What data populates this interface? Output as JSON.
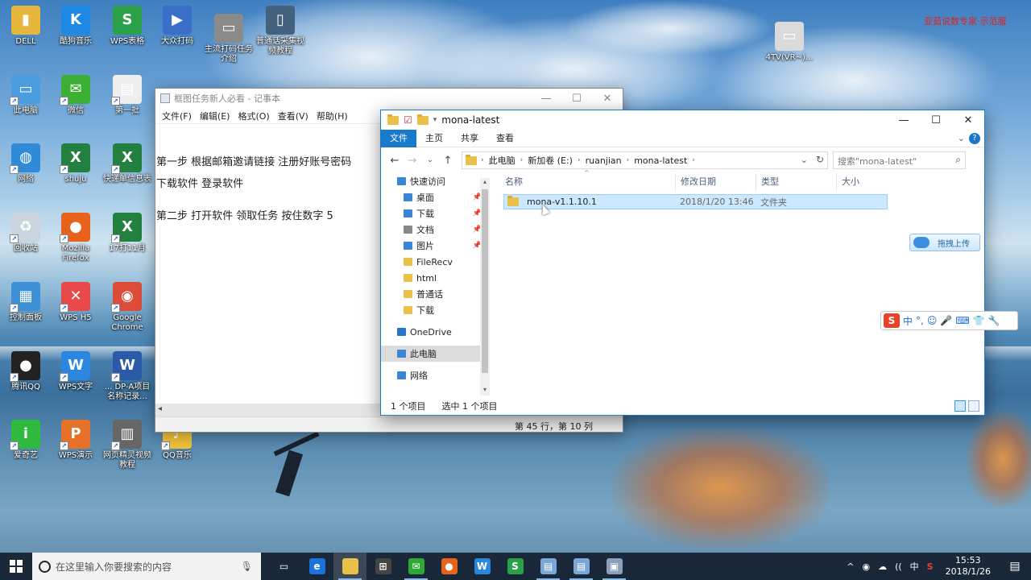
{
  "desktop": {
    "top_right_note": "亚茹说数专家·示范服",
    "icons": [
      {
        "label": "DELL",
        "icon": "user-folder-icon",
        "color": "#e7b63c"
      },
      {
        "label": "酷狗音乐",
        "icon": "kugou-icon",
        "color": "#1e88e5"
      },
      {
        "label": "WPS表格",
        "icon": "wps-sheet-icon",
        "color": "#2aa148"
      },
      {
        "label": "大众打码",
        "icon": "video-file-icon",
        "color": "#3a6fc9"
      },
      {
        "label": "主流打码任务介绍",
        "icon": "screen-icon",
        "color": "#8a8a8a"
      },
      {
        "label": "普通话采集视频教程",
        "icon": "phone-icon",
        "color": "#44617d"
      },
      {
        "label": "4TV(VR~)...",
        "icon": "tv-icon",
        "color": "#dadada"
      },
      {
        "label": "此电脑",
        "icon": "computer-icon",
        "color": "#4c9de0"
      },
      {
        "label": "微信",
        "icon": "wechat-icon",
        "color": "#3cb034"
      },
      {
        "label": "第一批",
        "icon": "document-icon",
        "color": "#eeeeee"
      },
      {
        "label": "网络",
        "icon": "network-icon",
        "color": "#2f8ad8"
      },
      {
        "label": "shuju",
        "icon": "excel-icon",
        "color": "#22813f"
      },
      {
        "label": "快递单信息表",
        "icon": "excel-icon",
        "color": "#22813f"
      },
      {
        "label": "回收站",
        "icon": "recycle-bin-icon",
        "color": "#c9d4de"
      },
      {
        "label": "Mozilla Firefox",
        "icon": "firefox-icon",
        "color": "#e8621c"
      },
      {
        "label": "17打11月",
        "icon": "excel-icon",
        "color": "#22813f"
      },
      {
        "label": "控制面板",
        "icon": "control-panel-icon",
        "color": "#3d8fd6"
      },
      {
        "label": "WPS H5",
        "icon": "wps-h5-icon",
        "color": "#e84a4a"
      },
      {
        "label": "Google Chrome",
        "icon": "chrome-icon",
        "color": "#dd4b39"
      },
      {
        "label": "腾讯QQ",
        "icon": "qq-icon",
        "color": "#222222"
      },
      {
        "label": "WPS文字",
        "icon": "wps-writer-icon",
        "color": "#2b86e0"
      },
      {
        "label": "... DP-A项目名称记录...",
        "icon": "word-icon",
        "color": "#2b5aa8"
      },
      {
        "label": "爱奇艺",
        "icon": "iqiyi-icon",
        "color": "#2fb93e"
      },
      {
        "label": "WPS演示",
        "icon": "wps-slides-icon",
        "color": "#e8712a"
      },
      {
        "label": "网页精灵视频教程",
        "icon": "film-icon",
        "color": "#666666"
      },
      {
        "label": "QQ音乐",
        "icon": "qq-music-icon",
        "color": "#f2c33a"
      }
    ]
  },
  "notepad": {
    "title": "框图任务新人必看 - 记事本",
    "menu": [
      "文件(F)",
      "编辑(E)",
      "格式(O)",
      "查看(V)",
      "帮助(H)"
    ],
    "lines": [
      "第一步   根据邮箱邀请链接 注册好账号密码",
      "下载软件  登录软件",
      "",
      "第二步  打开软件  领取任务   按住数字  5"
    ],
    "status": "第 45 行，第 10 列",
    "controls": {
      "min": "—",
      "max": "☐",
      "close": "✕"
    }
  },
  "explorer": {
    "title": "mona-latest",
    "ribbon_tabs": [
      "文件",
      "主页",
      "共享",
      "查看"
    ],
    "help": "?",
    "breadcrumb": [
      "此电脑",
      "新加卷 (E:)",
      "ruanjian",
      "mona-latest"
    ],
    "search_placeholder": "搜索\"mona-latest\"",
    "nav_items": [
      {
        "label": "快速访问",
        "pinned": false,
        "indent": 0,
        "icon": "star-icon"
      },
      {
        "label": "桌面",
        "pinned": true,
        "indent": 1,
        "icon": "desktop-icon"
      },
      {
        "label": "下载",
        "pinned": true,
        "indent": 1,
        "icon": "download-icon"
      },
      {
        "label": "文档",
        "pinned": true,
        "indent": 1,
        "icon": "document-icon"
      },
      {
        "label": "图片",
        "pinned": true,
        "indent": 1,
        "icon": "picture-icon"
      },
      {
        "label": "FileRecv",
        "pinned": false,
        "indent": 1,
        "icon": "folder-icon"
      },
      {
        "label": "html",
        "pinned": false,
        "indent": 1,
        "icon": "folder-icon"
      },
      {
        "label": "普通话",
        "pinned": false,
        "indent": 1,
        "icon": "folder-icon"
      },
      {
        "label": "下载",
        "pinned": false,
        "indent": 1,
        "icon": "folder-icon"
      },
      {
        "label": "OneDrive",
        "pinned": false,
        "indent": 0,
        "icon": "cloud-icon"
      },
      {
        "label": "此电脑",
        "pinned": false,
        "indent": 0,
        "icon": "computer-icon",
        "selected": true
      },
      {
        "label": "网络",
        "pinned": false,
        "indent": 0,
        "icon": "network-icon"
      }
    ],
    "columns": [
      "名称",
      "修改日期",
      "类型",
      "大小"
    ],
    "files": [
      {
        "name": "mona-v1.1.10.1",
        "date": "2018/1/20 13:46",
        "type": "文件夹",
        "size": ""
      }
    ],
    "status_count": "1 个项目",
    "status_selected": "选中 1 个项目"
  },
  "overlays": {
    "upload_button": "拖拽上传",
    "ime": [
      "中",
      "°,",
      "☺",
      "🎤",
      "⌨",
      "👕",
      "🔧"
    ],
    "ime_logo": "S"
  },
  "taskbar": {
    "search_placeholder": "在这里输入你要搜索的内容",
    "apps": [
      {
        "name": "task-view",
        "label": "▭",
        "color": "transparent",
        "open": false
      },
      {
        "name": "edge",
        "label": "e",
        "color": "#1a73d9",
        "open": false
      },
      {
        "name": "file-explorer",
        "label": "",
        "color": "#e8c04a",
        "open": true,
        "active": true
      },
      {
        "name": "store",
        "label": "⊞",
        "color": "#444444",
        "open": false
      },
      {
        "name": "wechat",
        "label": "✉",
        "color": "#2fa836",
        "open": true
      },
      {
        "name": "firefox",
        "label": "●",
        "color": "#e8621c",
        "open": false
      },
      {
        "name": "wps-writer",
        "label": "W",
        "color": "#2b86e0",
        "open": false
      },
      {
        "name": "wps-sheet",
        "label": "S",
        "color": "#2aa148",
        "open": false
      },
      {
        "name": "notepad",
        "label": "▤",
        "color": "#7aa7d8",
        "open": true
      },
      {
        "name": "notepad-2",
        "label": "▤",
        "color": "#7aa7d8",
        "open": true
      },
      {
        "name": "tool",
        "label": "▣",
        "color": "#8aa0bc",
        "open": true
      }
    ],
    "tray_icons": [
      "^",
      "◉",
      "☁",
      "((",
      "中",
      "S"
    ],
    "time": "15:53",
    "date": "2018/1/26",
    "notification": "▤"
  }
}
